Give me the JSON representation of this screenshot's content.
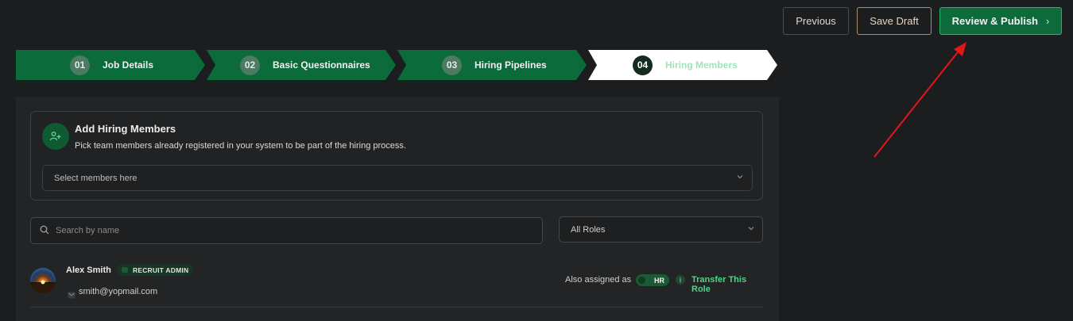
{
  "actions": {
    "previous_label": "Previous",
    "save_draft_label": "Save Draft",
    "review_publish_label": "Review & Publish",
    "review_publish_chevron": "›"
  },
  "steps": [
    {
      "number": "01",
      "label": "Job Details",
      "state": "done"
    },
    {
      "number": "02",
      "label": "Basic Questionnaires",
      "state": "done"
    },
    {
      "number": "03",
      "label": "Hiring Pipelines",
      "state": "done"
    },
    {
      "number": "04",
      "label": "Hiring Members",
      "state": "active"
    }
  ],
  "add_members": {
    "title": "Add Hiring Members",
    "description": "Pick team members already registered in your system to be part of the hiring process.",
    "select_placeholder": "Select members here",
    "icon": "users-plus-icon"
  },
  "filters": {
    "search_placeholder": "Search by name",
    "role_selected": "All Roles"
  },
  "members": [
    {
      "name": "Alex Smith",
      "role": "RECRUIT ADMIN",
      "email": "smith@yopmail.com",
      "also_assigned_label": "Also assigned as",
      "assigned_role": "HR",
      "transfer_label": "Transfer This Role",
      "info_glyph": "i"
    }
  ],
  "colors": {
    "background": "#1b1d1e",
    "panel": "#222425",
    "brand_green": "#0b6b3a",
    "accent_green": "#4fd585",
    "annotation_red": "#e3161b"
  }
}
